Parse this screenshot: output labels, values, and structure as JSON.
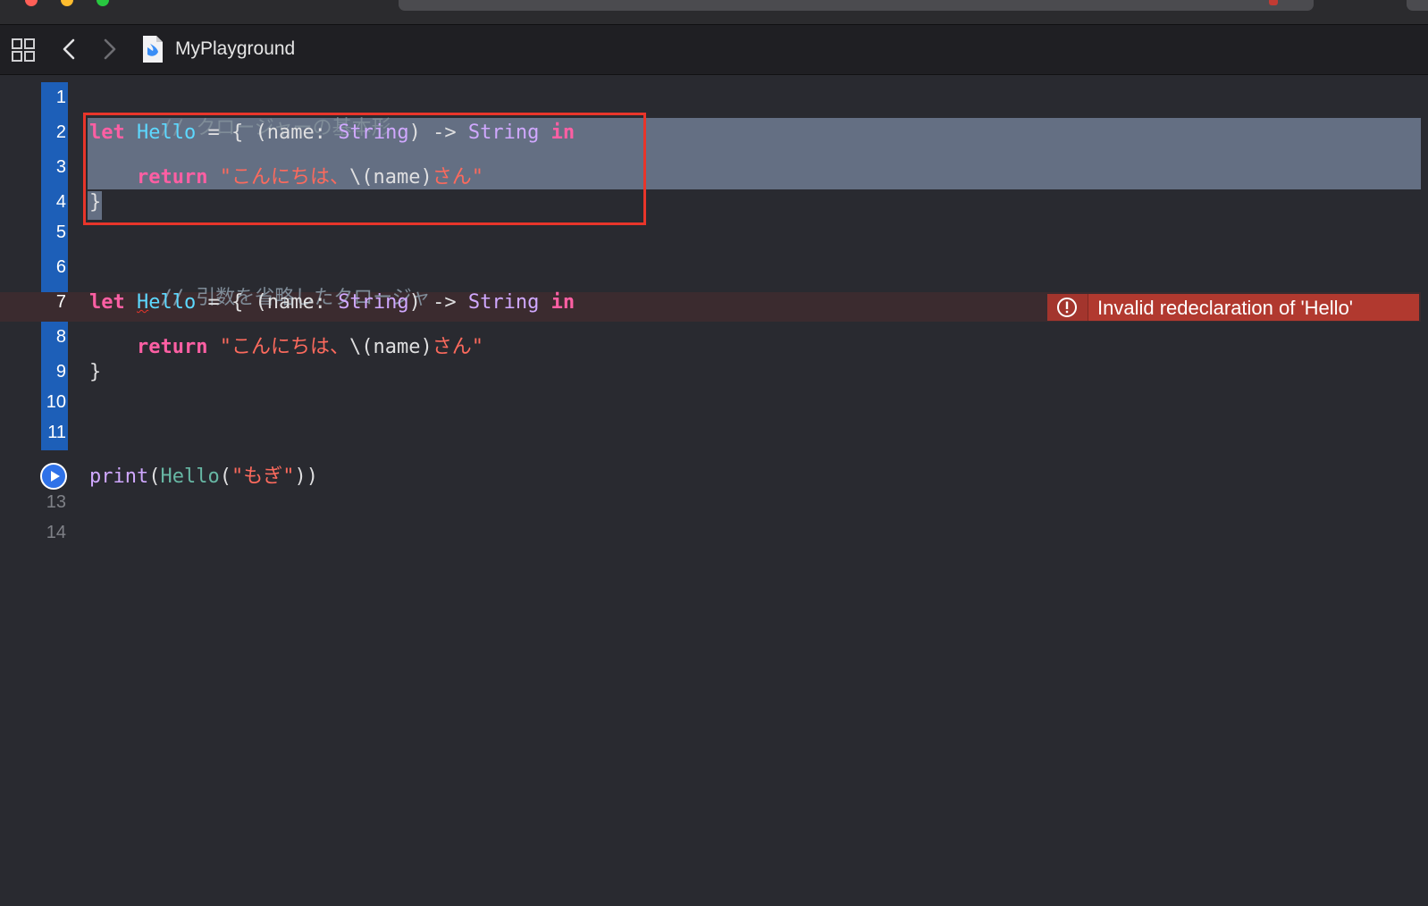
{
  "window": {
    "title": "MyPlayground"
  },
  "jumpbar": {
    "file_name": "MyPlayground"
  },
  "editor": {
    "line_numbers": [
      "1",
      "2",
      "3",
      "4",
      "5",
      "6",
      "7",
      "8",
      "9",
      "10",
      "11",
      "13",
      "14"
    ],
    "lines": {
      "l1": {
        "comment": "// クロージャーの基本形"
      },
      "l2": {
        "kw_let": "let",
        "name": "Hello",
        "eq": " = { (name: ",
        "type1": "String",
        "arrow": ") -> ",
        "type2": "String",
        "kw_in": "in"
      },
      "l3": {
        "indent": "    ",
        "kw_return": "return",
        "str_open": " \"こんにちは、",
        "interp": "\\(name)",
        "str_close": "さん\""
      },
      "l4": {
        "brace": "}"
      },
      "l6": {
        "comment": "// 引数を省略したクロージャ"
      },
      "l7": {
        "kw_let": "let",
        "name_h": "H",
        "name_rest": "ello",
        "eq": " = { (name: ",
        "type1": "String",
        "arrow": ") -> ",
        "type2": "String",
        "kw_in": "in"
      },
      "l8": {
        "indent": "    ",
        "kw_return": "return",
        "str_open": " \"こんにちは、",
        "interp": "\\(name)",
        "str_close": "さん\""
      },
      "l9": {
        "brace": "}"
      },
      "l12": {
        "fn": "print",
        "p1": "(",
        "call": "Hello",
        "p2": "(",
        "arg": "\"もぎ\"",
        "p3": "))"
      }
    },
    "error": {
      "message": "Invalid redeclaration of 'Hello'",
      "icon": "error-exclamation-icon",
      "color": "#b1392f"
    }
  },
  "colors": {
    "background": "#292a30",
    "gutter_accent": "#1d5fb8",
    "selection": "#646f83",
    "annotation_box": "#e8352a"
  }
}
